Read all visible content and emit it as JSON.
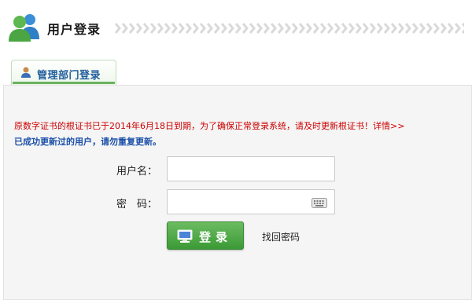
{
  "header": {
    "title": "用户登录",
    "logo_icon": "users-icon"
  },
  "tab": {
    "label": "管理部门登录",
    "icon": "user-icon"
  },
  "notice": {
    "text": "原数字证书的根证书已于2014年6月18日到期，为了确保正常登录系统，请及时更新根证书！详情>>",
    "sub_text": "已成功更新过的用户，请勿重复更新。"
  },
  "form": {
    "username_label": "用户名：",
    "username_value": "",
    "password_label": "密　码：",
    "password_value": "",
    "keyboard_icon": "keyboard-icon",
    "login_label": "登录",
    "login_icon": "monitor-icon",
    "forgot_password": "找回密码"
  },
  "colors": {
    "accent_green": "#4aa542",
    "notice_red": "#cc0000",
    "notice_blue": "#1a4fa8",
    "tab_text_blue": "#1f5d9b"
  }
}
